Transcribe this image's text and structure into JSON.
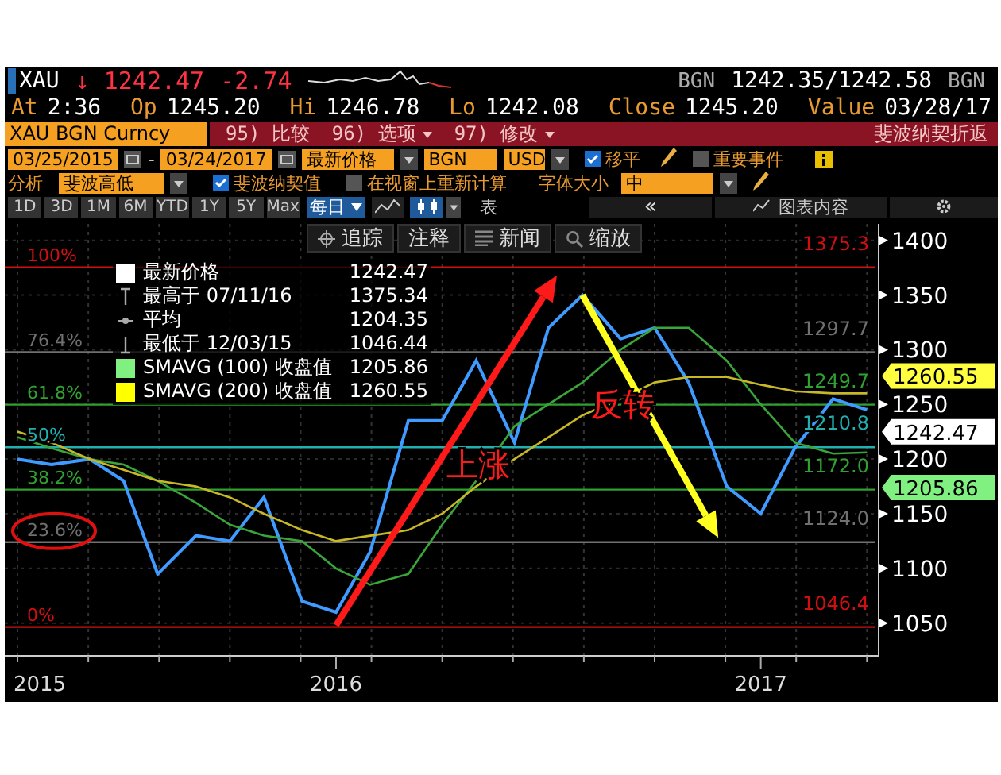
{
  "quote": {
    "ticker": "XAU",
    "arrow": "↓",
    "last": "1242.47",
    "change": "-2.74",
    "bid_source": "BGN",
    "bid_ask": "1242.35/1242.58",
    "ask_source": "BGN"
  },
  "stats": [
    {
      "label": "At",
      "value": "2:36"
    },
    {
      "label": "Op",
      "value": "1245.20"
    },
    {
      "label": "Hi",
      "value": "1246.78"
    },
    {
      "label": "Lo",
      "value": "1242.08"
    },
    {
      "label": "Close",
      "value": "1245.20"
    },
    {
      "label": "Value",
      "value": "03/28/17"
    }
  ],
  "command_bar": {
    "security": "XAU BGN Curncy",
    "menus": [
      {
        "label": "95) 比较",
        "dropdown": false
      },
      {
        "label": "96) 选项",
        "dropdown": true
      },
      {
        "label": "97) 修改",
        "dropdown": true
      }
    ],
    "title": "斐波纳契折返"
  },
  "settings_row": {
    "start_date": "03/25/2015",
    "separator": "-",
    "end_date": "03/24/2017",
    "price_field": "最新价格",
    "source": "BGN",
    "currency": "USD",
    "options": [
      {
        "label": "移平",
        "checked": true
      },
      {
        "label": "重要事件",
        "checked": false
      }
    ]
  },
  "analysis_row": {
    "label": "分析",
    "study": "斐波高低",
    "options": [
      {
        "label": "斐波纳契值",
        "checked": true
      },
      {
        "label": "在视窗上重新计算",
        "checked": false
      }
    ],
    "font_size_label": "字体大小",
    "font_size": "中"
  },
  "toolbar": {
    "ranges": [
      {
        "label": "1D",
        "selected": false
      },
      {
        "label": "3D",
        "selected": false
      },
      {
        "label": "1M",
        "selected": false
      },
      {
        "label": "6M",
        "selected": false
      },
      {
        "label": "YTD",
        "selected": false
      },
      {
        "label": "1Y",
        "selected": false
      },
      {
        "label": "5Y",
        "selected": false
      },
      {
        "label": "Max",
        "selected": false
      }
    ],
    "frequency": "每日",
    "cut_label": "表",
    "back": "«",
    "chart_contents": "图表内容"
  },
  "chart_tools": [
    {
      "kind": "crosshair",
      "label": "追踪"
    },
    {
      "kind": "plain",
      "label": "注释"
    },
    {
      "kind": "news",
      "label": "新闻"
    },
    {
      "kind": "zoom",
      "label": "缩放"
    }
  ],
  "legend": [
    {
      "kind": "swatch",
      "color": "#ffffff",
      "value": "1242.47"
    },
    {
      "kind": "high",
      "label": "最高于 07/11/16",
      "value": "1375.34"
    },
    {
      "kind": "average",
      "label": "平均",
      "value": "1204.35"
    },
    {
      "kind": "low",
      "label": "最低于 12/03/15",
      "value": "1046.44"
    },
    {
      "kind": "swatch",
      "color": "#80f080",
      "value": "1205.86"
    },
    {
      "kind": "swatch",
      "color": "#ffff00",
      "value": "1260.55"
    }
  ],
  "first_year_label": "2015",
  "fibonacci_labels": [
    {
      "text": "100%",
      "circled": false
    },
    {
      "text": "76.4%",
      "circled": false
    },
    {
      "text": "61.8%",
      "circled": false
    },
    {
      "text": "50%",
      "circled": false
    },
    {
      "text": "38.2%",
      "circled": false
    },
    {
      "text": "23.6%",
      "circled": true
    },
    {
      "text": "0%",
      "circled": false
    }
  ],
  "price_tags": [
    {
      "text": "1260.55",
      "color": "#ffff40"
    },
    {
      "text": "1242.47",
      "color": "#ffffff"
    },
    {
      "text": "1205.86",
      "color": "#80f080"
    }
  ],
  "chart_data": {
    "type": "line",
    "x": [
      2015.25,
      2015.33,
      2015.42,
      2015.5,
      2015.58,
      2015.67,
      2015.75,
      2015.83,
      2015.92,
      2016.0,
      2016.08,
      2016.17,
      2016.25,
      2016.33,
      2016.42,
      2016.5,
      2016.58,
      2016.67,
      2016.75,
      2016.83,
      2016.92,
      2017.0,
      2017.08,
      2017.17,
      2017.25
    ],
    "series": [
      {
        "name": "最新价格",
        "color": "#3f9bff",
        "values": [
          1200,
          1195,
          1200,
          1180,
          1095,
          1130,
          1125,
          1165,
          1070,
          1060,
          1115,
          1235,
          1235,
          1290,
          1215,
          1320,
          1350,
          1310,
          1320,
          1270,
          1175,
          1150,
          1210,
          1255,
          1245
        ]
      },
      {
        "name": "SMAVG (100) 收盘值",
        "color": "#3aa63a",
        "values": [
          1220,
          1210,
          1200,
          1195,
          1180,
          1160,
          1140,
          1130,
          1125,
          1100,
          1085,
          1095,
          1140,
          1180,
          1230,
          1250,
          1270,
          1300,
          1320,
          1320,
          1290,
          1250,
          1215,
          1205,
          1206
        ]
      },
      {
        "name": "SMAVG (200) 收盘值",
        "color": "#c8b828",
        "values": [
          1225,
          1215,
          1200,
          1190,
          1180,
          1175,
          1165,
          1150,
          1135,
          1125,
          1130,
          1135,
          1150,
          1175,
          1200,
          1220,
          1240,
          1255,
          1270,
          1275,
          1275,
          1268,
          1262,
          1260,
          1260
        ]
      }
    ],
    "xlim": [
      2015.22,
      2017.27
    ],
    "ylim": [
      1020,
      1415
    ],
    "xticks": [
      2016,
      2017
    ],
    "yticks": [
      1050,
      1100,
      1150,
      1200,
      1250,
      1300,
      1350,
      1400
    ],
    "grid": true,
    "ref_lines": [
      {
        "axis": "y",
        "value": 1375.34,
        "color": "#d01010",
        "label": "1375.3"
      },
      {
        "axis": "y",
        "value": 1297.7,
        "color": "#707070",
        "label": "1297.7"
      },
      {
        "axis": "y",
        "value": 1249.7,
        "color": "#30a030",
        "label": "1249.7"
      },
      {
        "axis": "y",
        "value": 1210.8,
        "color": "#20b0b0",
        "label": "1210.8"
      },
      {
        "axis": "y",
        "value": 1172.0,
        "color": "#30a030",
        "label": "1172.0"
      },
      {
        "axis": "y",
        "value": 1124.0,
        "color": "#707070",
        "label": "1124.0"
      },
      {
        "axis": "y",
        "value": 1046.4,
        "color": "#d01010",
        "label": "1046.4"
      }
    ],
    "annotations": [
      "上涨",
      "反转"
    ]
  }
}
